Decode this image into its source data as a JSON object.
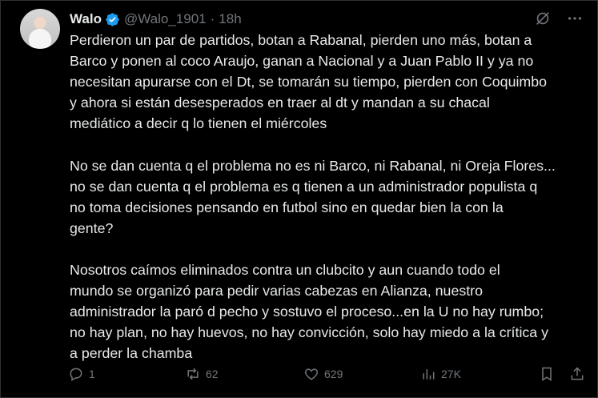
{
  "tweet": {
    "author_name": "Walo",
    "handle": "@Walo_1901",
    "separator": "·",
    "time": "18h",
    "paragraphs": [
      "Perdieron un par de partidos, botan a Rabanal, pierden uno más, botan a\nBarco y ponen al coco Araujo, ganan a Nacional y a Juan Pablo II y ya no\nnecesitan apurarse con el Dt, se tomarán su tiempo, pierden con Coquimbo\ny ahora si están desesperados en traer al dt y mandan a su chacal\nmediático a decir q lo tienen el miércoles",
      "No se dan cuenta q el problema no es ni Barco, ni Rabanal, ni Oreja Flores...\nno se dan cuenta q el problema es q tienen a un administrador populista q\nno toma decisiones pensando en futbol sino en quedar bien la con la\ngente?",
      "Nosotros caímos eliminados contra un clubcito y aun cuando todo el\nmundo se organizó para pedir varias cabezas en Alianza, nuestro\nadministrador la paró d pecho y sostuvo el proceso...en la U no hay rumbo;\nno hay plan, no hay huevos, no hay convicción, solo hay miedo a la crítica y\na perder la chamba"
    ],
    "stats": {
      "replies": "1",
      "reposts": "62",
      "likes": "629",
      "views": "27K"
    },
    "colors": {
      "background": "#000000",
      "text": "#e7e9ea",
      "secondary": "#71767b",
      "verified": "#1d9bf0"
    },
    "icons": [
      "verified-badge-icon",
      "grok-icon",
      "more-icon",
      "reply-icon",
      "repost-icon",
      "like-icon",
      "views-icon",
      "bookmark-icon",
      "share-icon"
    ]
  }
}
